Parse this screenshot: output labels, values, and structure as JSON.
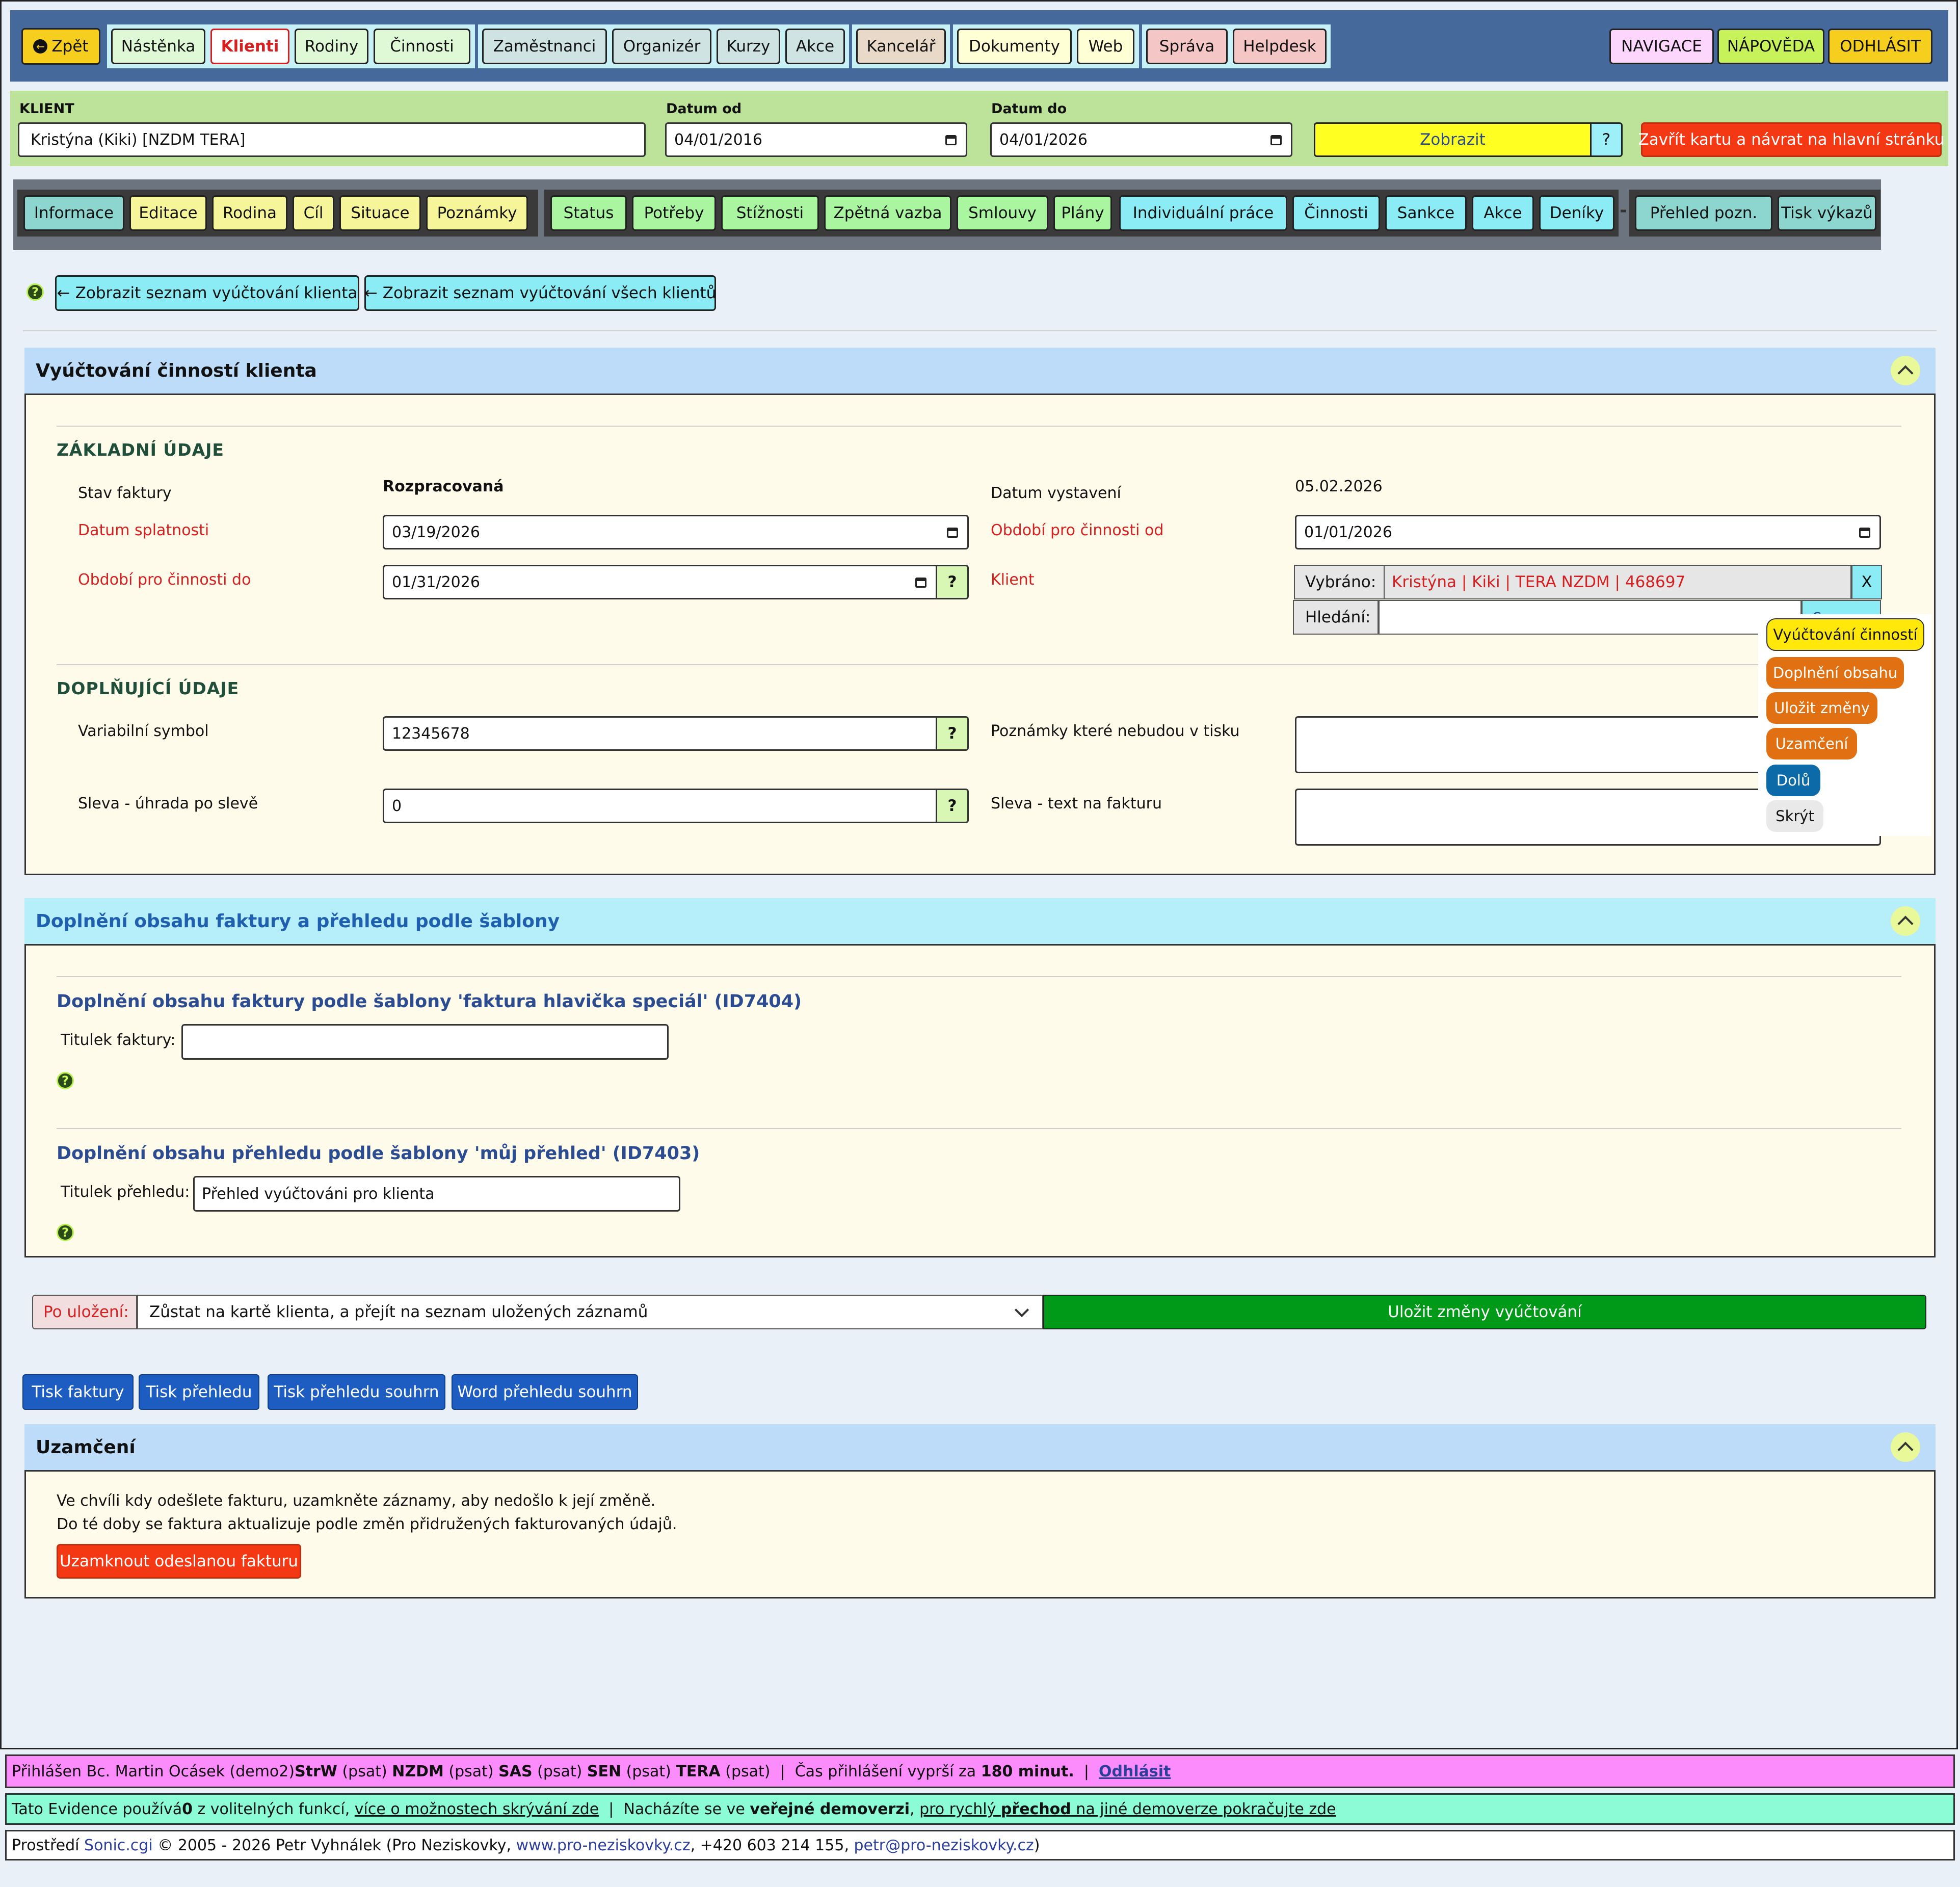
{
  "topnav": {
    "back": "Zpět",
    "groups": [
      [
        "Nástěnka",
        "Klienti",
        "Rodiny",
        "Činnosti"
      ],
      [
        "Zaměstnanci",
        "Organizér",
        "Kurzy",
        "Akce"
      ],
      [
        "Kancelář"
      ],
      [
        "Dokumenty",
        "Web"
      ],
      [
        "Správa",
        "Helpdesk"
      ]
    ],
    "navigace": "NAVIGACE",
    "napoveda": "NÁPOVĚDA",
    "odhlasit": "ODHLÁSIT"
  },
  "filter": {
    "klient_label": "KLIENT",
    "klient_value": "Kristýna (Kiki) [NZDM TERA]",
    "datum_od_label": "Datum od",
    "datum_od_value": "04/01/2016",
    "datum_do_label": "Datum do",
    "datum_do_value": "04/01/2026",
    "zobrazit": "Zobrazit",
    "help": "?",
    "zavrit": "Zavřít kartu a návrat na hlavní stránku"
  },
  "tabs": {
    "group1": [
      "Informace",
      "Editace",
      "Rodina",
      "Cíl",
      "Situace",
      "Poznámky"
    ],
    "group2": [
      "Status",
      "Potřeby",
      "Stížnosti",
      "Zpětná vazba",
      "Smlouvy",
      "Plány"
    ],
    "group3": [
      "Individuální práce",
      "Činnosti",
      "Sankce",
      "Akce",
      "Deníky"
    ],
    "sep": "-",
    "group4": [
      "Přehled pozn.",
      "Tisk výkazů"
    ]
  },
  "actions": {
    "list_client": "Zobrazit seznam vyúčtování klienta",
    "list_all": "Zobrazit seznam vyúčtování všech klientů"
  },
  "billing": {
    "title": "Vyúčtování činností klienta",
    "basic_title": "ZÁKLADNÍ ÚDAJE",
    "stav_label": "Stav faktury",
    "stav_value": "Rozpracovaná",
    "vystaveni_label": "Datum vystavení",
    "vystaveni_value": "05.02.2026",
    "splatnost_label": "Datum splatnosti",
    "splatnost_value": "03/19/2026",
    "obdobi_od_label": "Období pro činnosti od",
    "obdobi_od_value": "01/01/2026",
    "obdobi_do_label": "Období pro činnosti do",
    "obdobi_do_value": "01/31/2026",
    "klient_label": "Klient",
    "vybrano_label": "Vybráno:",
    "vybrano_value": "Kristýna | Kiki | TERA NZDM | 468697",
    "vybrano_clear": "X",
    "hledani_label": "Hledání:",
    "seznam_partial": "Seznam",
    "extra_title": "DOPLŇUJÍCÍ ÚDAJE",
    "vs_label": "Variabilní symbol",
    "vs_value": "12345678",
    "pozn_label": "Poznámky které nebudou v tisku",
    "sleva_label": "Sleva - úhrada po slevě",
    "sleva_value": "0",
    "sleva_text_label": "Sleva - text na fakturu",
    "q": "?"
  },
  "floating": [
    "Vyúčtování činností",
    "Doplnění obsahu",
    "Uložit změny",
    "Uzamčení",
    "Dolů",
    "Skrýt"
  ],
  "template": {
    "title": "Doplnění obsahu faktury a přehledu podle šablony",
    "faktura_title": "Doplnění obsahu faktury podle šablony 'faktura hlavička speciál' (ID7404)",
    "titulek_faktury_label": "Titulek faktury:",
    "titulek_faktury_value": "",
    "prehled_title": "Doplnění obsahu přehledu podle šablony 'můj přehled' (ID7403)",
    "titulek_prehledu_label": "Titulek přehledu:",
    "titulek_prehledu_value": "Přehled vyúčtováni pro klienta"
  },
  "save": {
    "po_ulozeni": "Po uložení:",
    "option": "Zůstat na kartě klienta, a přejít na seznam uložených záznamů",
    "button": "Uložit změny vyúčtování"
  },
  "print": [
    "Tisk faktury",
    "Tisk přehledu",
    "Tisk přehledu souhrn",
    "Word přehledu souhrn"
  ],
  "lock": {
    "title": "Uzamčení",
    "line1": "Ve chvíli kdy odešlete fakturu, uzamkněte záznamy, aby nedošlo k její změně.",
    "line2": "Do té doby se faktura aktualizuje podle změn přidružených fakturovaných údajů.",
    "button": "Uzamknout odeslanou fakturu"
  },
  "footer": {
    "l1_a": "Přihlášen Bc. Martin Ocásek (demo2) ",
    "l1_strw": "StrW",
    "l1_psat1": " (psat) ",
    "l1_nzdm": "NZDM",
    "l1_psat2": " (psat) ",
    "l1_sas": "SAS",
    "l1_psat3": " (psat) ",
    "l1_sen": "SEN",
    "l1_psat4": " (psat) ",
    "l1_tera": "TERA",
    "l1_psat5": " (psat)  |  Čas přihlášení vyprší za ",
    "l1_min": "180 minut.",
    "l1_sep": "  |  ",
    "l1_logout": "Odhlásit",
    "l2_a": "Tato Evidence používá ",
    "l2_zero": "0",
    "l2_b": " z volitelných funkcí, ",
    "l2_link1": "více o možnostech skrývání zde",
    "l2_c": "  |  Nacházíte se ve ",
    "l2_demo": "veřejné demoverzi",
    "l2_d": ", ",
    "l2_link2a": "pro rychlý ",
    "l2_link2b": "přechod",
    "l2_link2c": " na jiné demoverze pokračujte zde",
    "l3_a": "Prostředí ",
    "l3_sonic": "Sonic.cgi",
    "l3_b": " © 2005 - 2026 Petr Vyhnálek (Pro Neziskovky, ",
    "l3_web": "www.pro-neziskovky.cz",
    "l3_c": ", +420 603 214 155, ",
    "l3_mail": "petr@pro-neziskovky.cz",
    "l3_d": ")"
  }
}
